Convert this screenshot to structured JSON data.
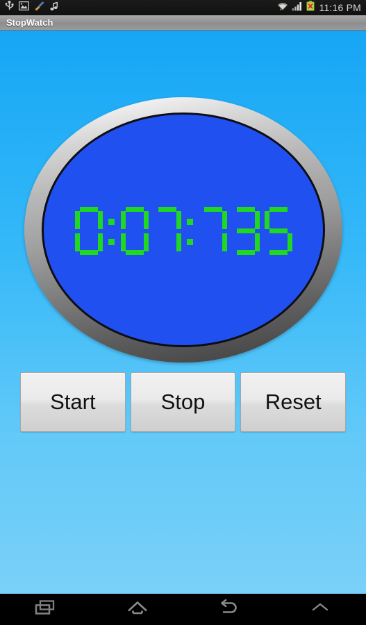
{
  "statusbar": {
    "time": "11:16 PM",
    "left_icons": [
      {
        "name": "usb-icon",
        "label": "USB connected"
      },
      {
        "name": "gallery-image-icon",
        "label": "Screenshot captured"
      },
      {
        "name": "broom-cleaner-icon",
        "label": "Cleaner"
      },
      {
        "name": "music-note-icon",
        "label": "Music playing"
      }
    ],
    "right_icons": [
      {
        "name": "wifi-icon",
        "label": "Wi-Fi connected"
      },
      {
        "name": "signal-bars-icon",
        "label": "Mobile signal"
      },
      {
        "name": "battery-icon",
        "label": "Battery not charging"
      }
    ]
  },
  "actionbar": {
    "title": "StopWatch"
  },
  "stopwatch": {
    "display": {
      "hours": "0",
      "separator1": ":",
      "minutes": "07",
      "separator2": ":",
      "milliseconds": "735",
      "full_text": "0:07:735"
    },
    "colors": {
      "segment_on": "#1fd81f",
      "face": "#2150f0",
      "background_top": "#16a6f5",
      "background_bottom": "#7ad0f8"
    }
  },
  "controls": {
    "buttons": [
      {
        "name": "start-button",
        "label": "Start"
      },
      {
        "name": "stop-button",
        "label": "Stop"
      },
      {
        "name": "reset-button",
        "label": "Reset"
      }
    ]
  },
  "navbar": {
    "buttons": [
      {
        "name": "recents-icon",
        "label": "Recent apps"
      },
      {
        "name": "home-icon",
        "label": "Home"
      },
      {
        "name": "back-icon",
        "label": "Back"
      },
      {
        "name": "chevron-up-icon",
        "label": "Expand"
      }
    ]
  }
}
